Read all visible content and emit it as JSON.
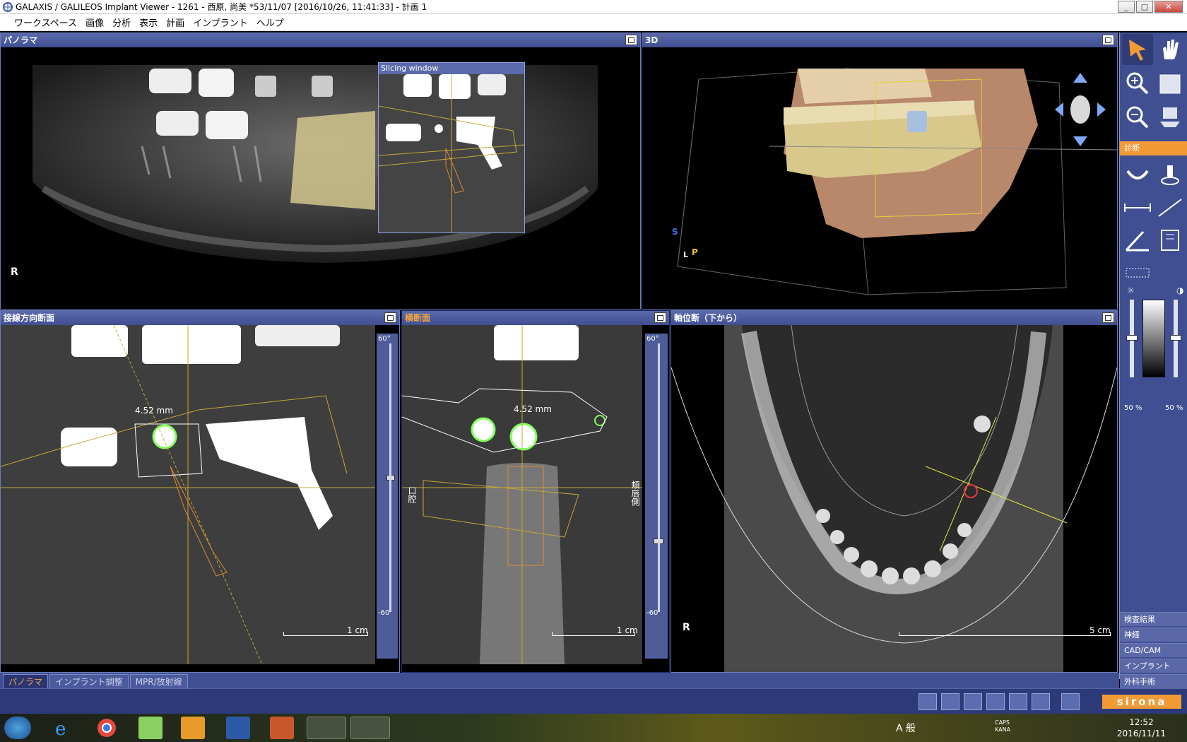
{
  "window": {
    "title": "GALAXIS / GALILEOS Implant Viewer - 1261 - 西原, 尚美 *53/11/07 [2016/10/26, 11:41:33] - 計画 1",
    "minimize": "_",
    "maximize": "□",
    "close": "✕"
  },
  "menu": [
    "ワークスペース",
    "画像",
    "分析",
    "表示",
    "計画",
    "インプラント",
    "ヘルプ"
  ],
  "panels": {
    "panorama": {
      "title": "パノラマ",
      "orientation": "R",
      "slicing_window": "Slicing window"
    },
    "view3d": {
      "title": "3D",
      "axis_s": "S",
      "axis_l": "L",
      "axis_p": "P"
    },
    "tangential": {
      "title": "接線方向断面",
      "measurement": "4.52 mm",
      "scale": "1 cm",
      "slider_top": "60°",
      "slider_bottom": "-60"
    },
    "cross": {
      "title": "横断面",
      "measurement": "4.52 mm",
      "scale": "1 cm",
      "left_label": "口腔",
      "right_label": "頬唇側",
      "slider_top": "60°",
      "slider_bottom": "-60"
    },
    "axial": {
      "title": "軸位断（下から）",
      "orientation": "R",
      "scale": "5 cm"
    }
  },
  "sidebar": {
    "section_diagnosis": "診断",
    "brightness": "50 %",
    "contrast": "50 %",
    "tabs": [
      "検査結果",
      "神経",
      "CAD/CAM",
      "インプラント",
      "外科手術"
    ]
  },
  "bottom_tabs": [
    "パノラマ",
    "インプラント調整",
    "MPR/放射線"
  ],
  "brand": "sirona",
  "taskbar": {
    "ime": "A 般",
    "caps": "CAPS",
    "kana": "KANA",
    "time": "12:52",
    "date": "2016/11/11"
  },
  "colors": {
    "panel_header": "#4a5a9e",
    "accent_orange": "#f19a36",
    "overlay_yellow": "#c8a832",
    "overlay_green": "#7fff5a"
  }
}
